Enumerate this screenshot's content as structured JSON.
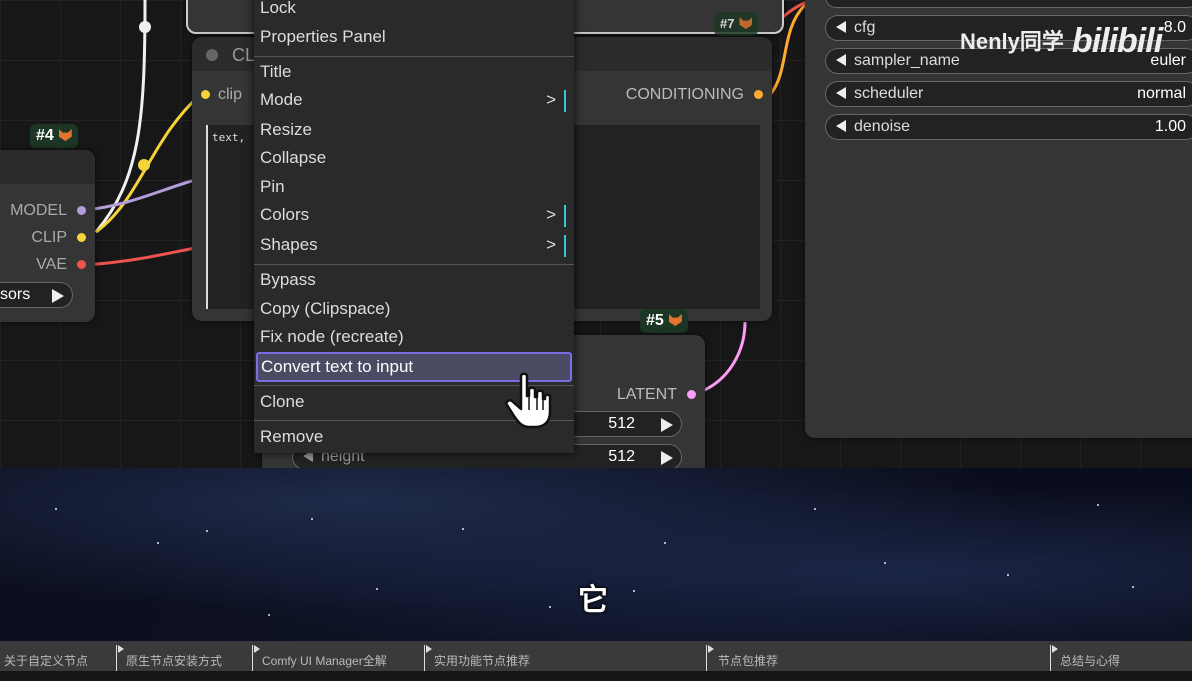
{
  "context_menu": {
    "items": [
      {
        "label": "Lock",
        "submenu": false
      },
      {
        "label": "Properties Panel",
        "submenu": false
      },
      {
        "label": "Title",
        "submenu": false
      },
      {
        "label": "Mode",
        "submenu": true
      },
      {
        "label": "Resize",
        "submenu": false
      },
      {
        "label": "Collapse",
        "submenu": false
      },
      {
        "label": "Pin",
        "submenu": false
      },
      {
        "label": "Colors",
        "submenu": true
      },
      {
        "label": "Shapes",
        "submenu": true
      },
      {
        "label": "Bypass",
        "submenu": false
      },
      {
        "label": "Copy (Clipspace)",
        "submenu": false
      },
      {
        "label": "Fix node (recreate)",
        "submenu": false
      },
      {
        "label": "Convert text to input",
        "submenu": false,
        "highlighted": true
      },
      {
        "label": "Clone",
        "submenu": false
      },
      {
        "label": "Remove",
        "submenu": false
      }
    ],
    "submenu_arrow": ">"
  },
  "nodes": {
    "checkpoint": {
      "badge": "#4",
      "outputs": [
        "MODEL",
        "CLIP",
        "VAE"
      ],
      "widget_fragment": "sors",
      "colors": {
        "MODEL": "#b39ddb",
        "CLIP": "#f5d43a",
        "VAE": "#ef5350"
      }
    },
    "clip_text_encode": {
      "title_fragment": "CL",
      "input": "clip",
      "output": "CONDITIONING",
      "text_fragment": "text,",
      "colors": {
        "clip": "#f5d43a",
        "CONDITIONING": "#ffa931"
      }
    },
    "latent": {
      "badge": "#5",
      "output": "LATENT",
      "width_value": "512",
      "height_label": "height",
      "height_value": "512",
      "colors": {
        "LATENT": "#ff9cf9"
      }
    },
    "top_badge_fragment": "#7",
    "sampler": {
      "widgets": [
        {
          "label": "cfg",
          "value": "8.0"
        },
        {
          "label": "sampler_name",
          "value": "euler"
        },
        {
          "label": "scheduler",
          "value": "normal"
        },
        {
          "label": "denoise",
          "value": "1.00"
        }
      ]
    }
  },
  "watermark": {
    "name": "Nenly同学",
    "logo": "bilibili"
  },
  "subtitle": "它",
  "chapters": [
    "关于自定义节点",
    "原生节点安装方式",
    "Comfy UI Manager全解",
    "实用功能节点推荐",
    "节点包推荐",
    "总结与心得"
  ]
}
